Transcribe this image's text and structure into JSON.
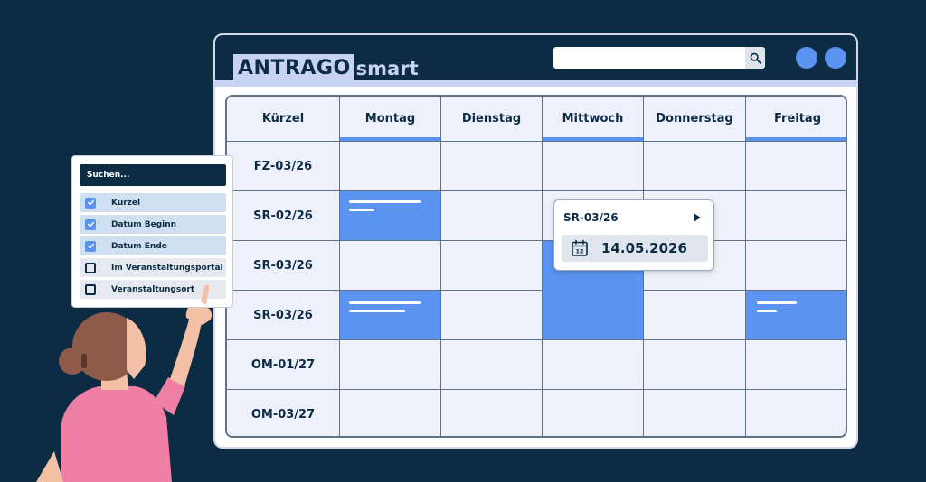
{
  "app": {
    "logo_main": "ANTRAGO",
    "logo_sub": "smart"
  },
  "toolbar": {
    "search_value": ""
  },
  "colors": {
    "navy": "#0c2c44",
    "accent_blue": "#5b93f0",
    "light_lavender": "#c7d2f4",
    "cell_bg": "#eef0fb"
  },
  "calendar": {
    "corner_header": "Kürzel",
    "days": [
      "Montag",
      "Dienstag",
      "Mittwoch",
      "Donnerstag",
      "Freitag"
    ],
    "rows": [
      "FZ-03/26",
      "SR-02/26",
      "SR-03/26",
      "SR-03/26",
      "OM-01/27",
      "OM-03/27"
    ]
  },
  "event_popup": {
    "title": "SR-03/26",
    "date": "14.05.2026",
    "calendar_day_number": "12"
  },
  "filter_panel": {
    "search_label": "Suchen...",
    "options": [
      {
        "label": "Kürzel",
        "checked": true
      },
      {
        "label": "Datum Beginn",
        "checked": true
      },
      {
        "label": "Datum Ende",
        "checked": true
      },
      {
        "label": "Im Veranstaltungsportal",
        "checked": false
      },
      {
        "label": "Veranstaltungsort",
        "checked": false
      }
    ]
  }
}
